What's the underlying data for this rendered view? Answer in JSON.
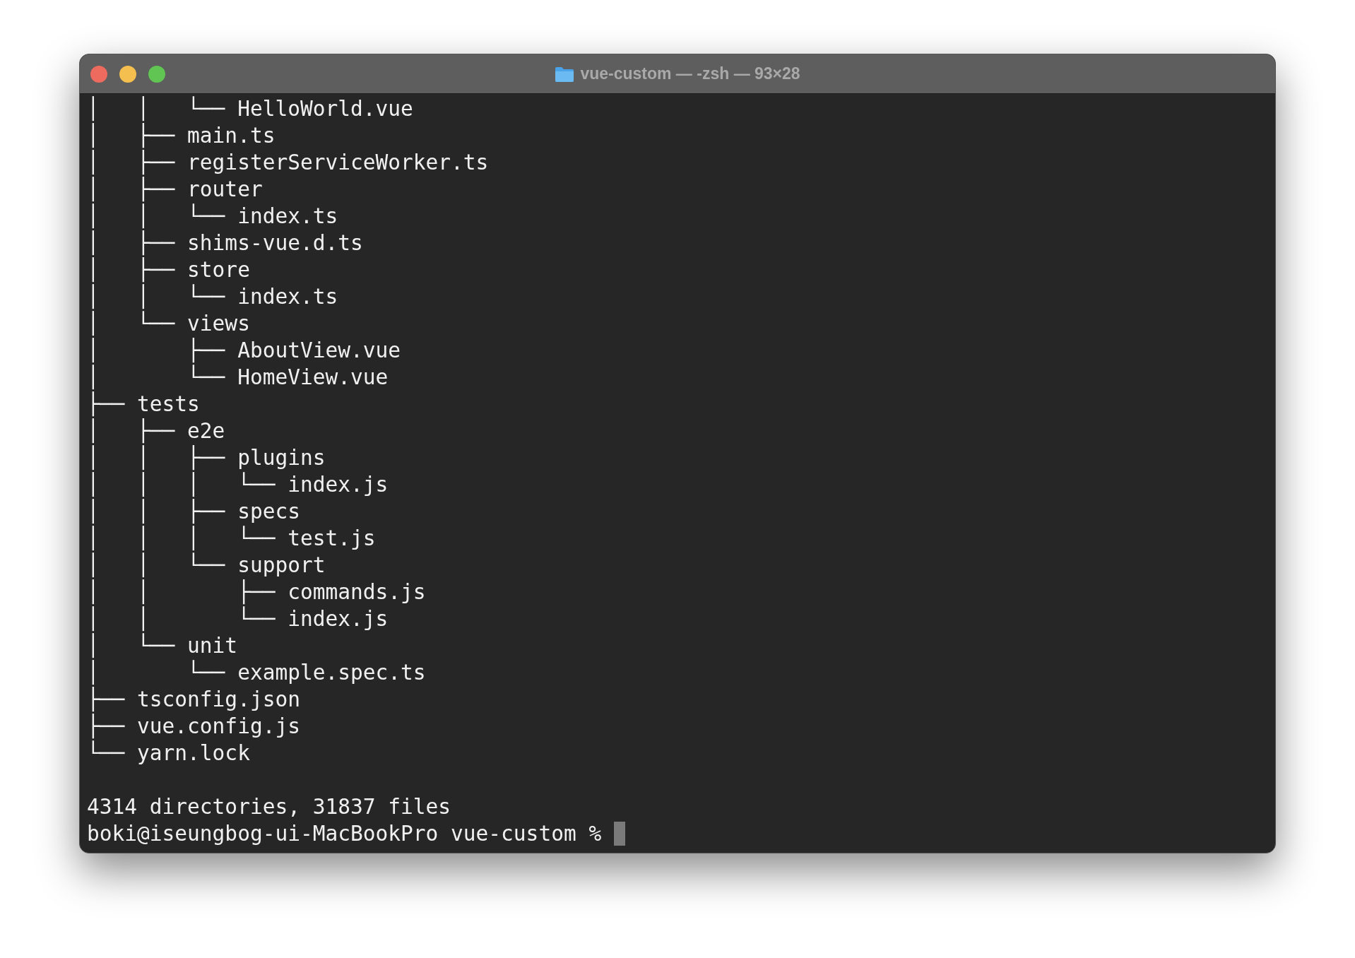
{
  "window": {
    "title": "vue-custom — -zsh — 93×28"
  },
  "terminal": {
    "lines": [
      "│   │   └── HelloWorld.vue",
      "│   ├── main.ts",
      "│   ├── registerServiceWorker.ts",
      "│   ├── router",
      "│   │   └── index.ts",
      "│   ├── shims-vue.d.ts",
      "│   ├── store",
      "│   │   └── index.ts",
      "│   └── views",
      "│       ├── AboutView.vue",
      "│       └── HomeView.vue",
      "├── tests",
      "│   ├── e2e",
      "│   │   ├── plugins",
      "│   │   │   └── index.js",
      "│   │   ├── specs",
      "│   │   │   └── test.js",
      "│   │   └── support",
      "│   │       ├── commands.js",
      "│   │       └── index.js",
      "│   └── unit",
      "│       └── example.spec.ts",
      "├── tsconfig.json",
      "├── vue.config.js",
      "└── yarn.lock"
    ],
    "summary": "4314 directories, 31837 files",
    "prompt": "boki@iseungbog-ui-MacBookPro vue-custom %"
  }
}
